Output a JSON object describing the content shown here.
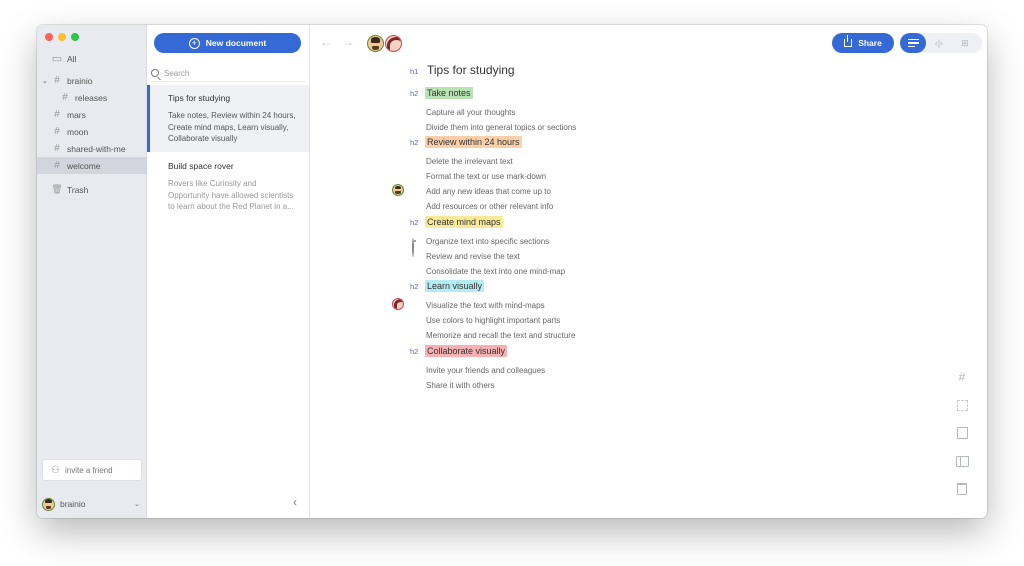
{
  "sidebar": {
    "all_label": "All",
    "tags": [
      {
        "label": "brainio",
        "indent": false,
        "expanded": true,
        "active": false
      },
      {
        "label": "releases",
        "indent": true,
        "active": false
      },
      {
        "label": "mars",
        "indent": false,
        "active": false
      },
      {
        "label": "moon",
        "indent": false,
        "active": false
      },
      {
        "label": "shared-with-me",
        "indent": false,
        "active": false
      },
      {
        "label": "welcome",
        "indent": false,
        "active": true
      }
    ],
    "trash_label": "Trash",
    "invite_label": "invite a friend",
    "user_name": "brainio"
  },
  "doclist": {
    "new_doc_label": "New document",
    "search_placeholder": "Search",
    "documents": [
      {
        "title": "Tips for studying",
        "preview": "Take notes, Review within 24 hours, Create mind maps, Learn visually, Collaborate visually",
        "selected": true
      },
      {
        "title": "Build space rover",
        "preview": "Rovers like Curiosity and Opportunity have allowed scientists to learn about the Red Planet in a...",
        "selected": false
      }
    ]
  },
  "editor": {
    "share_label": "Share",
    "h1_tag": "h1",
    "h2_tag": "h2",
    "title": "Tips for studying",
    "sections": [
      {
        "heading": "Take notes",
        "highlight": "#b9e2b4",
        "items": [
          "Capture all your thoughts",
          "Divide them into general topics or sections"
        ]
      },
      {
        "heading": "Review within 24 hours",
        "highlight": "#fbd0a8",
        "items": [
          "Delete the irrelevant text",
          "Format the text or use mark-down",
          "Add any new ideas that come up to",
          "Add resources or other relevant info"
        ]
      },
      {
        "heading": "Create mind maps",
        "highlight": "#f9ea98",
        "items": [
          "Organize text into specific sections",
          "Review and revise the text",
          "Consolidate the text into one mind-map"
        ]
      },
      {
        "heading": "Learn visually",
        "highlight": "#b4ecf4",
        "items": [
          "Visualize the text with mind-maps",
          "Use colors to highlight important parts",
          "Memorize and recall the text and structure"
        ]
      },
      {
        "heading": "Collaborate visually",
        "highlight": "#f6b2b2",
        "items": [
          "Invite your friends and colleagues",
          "Share it with others"
        ]
      }
    ]
  },
  "icons": {
    "hash": "#",
    "folder": "▭",
    "trash": "🗑",
    "back": "←",
    "forward": "→",
    "collapse": "‹",
    "code": "‹|›",
    "mindmap": "⊞"
  },
  "colors": {
    "accent": "#3469d6",
    "sidebar_bg": "#e9eaf0",
    "active_item": "#d2d4de"
  }
}
